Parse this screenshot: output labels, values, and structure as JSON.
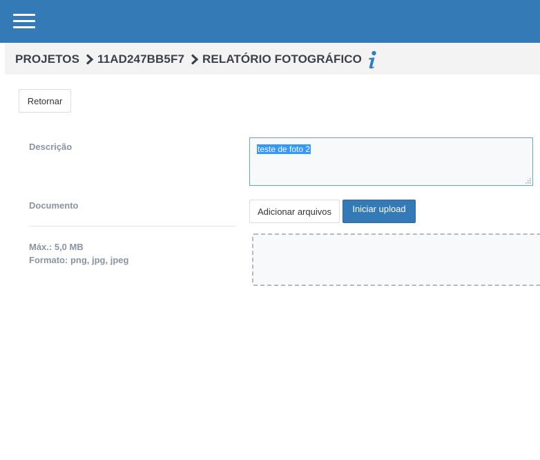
{
  "header": {
    "menu_icon": "hamburger-menu-icon",
    "color": "#337ab7"
  },
  "breadcrumb": {
    "items": [
      "PROJETOS",
      "11AD247BB5F7",
      "RELATÓRIO FOTOGRÁFICO"
    ],
    "separator_icon": "chevron-right-icon",
    "info_icon": "info-icon"
  },
  "actions": {
    "back_label": "Retornar"
  },
  "form": {
    "description_label": "Descrição",
    "description_value": "teste de foto 2",
    "document_label": "Documento",
    "add_files_label": "Adicionar arquivos",
    "start_upload_label": "Iniciar upload",
    "max_size": "Máx.: 5,0 MB",
    "formats": "Formato: png, jpg, jpeg"
  }
}
